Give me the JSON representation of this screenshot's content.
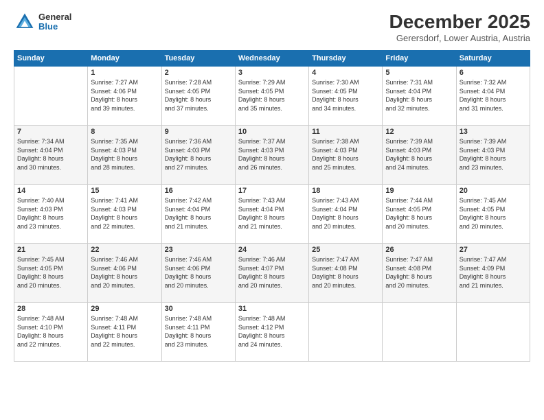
{
  "logo": {
    "general": "General",
    "blue": "Blue"
  },
  "title": "December 2025",
  "location": "Gerersdorf, Lower Austria, Austria",
  "days_of_week": [
    "Sunday",
    "Monday",
    "Tuesday",
    "Wednesday",
    "Thursday",
    "Friday",
    "Saturday"
  ],
  "weeks": [
    [
      {
        "day": "",
        "sunrise": "",
        "sunset": "",
        "daylight": ""
      },
      {
        "day": "1",
        "sunrise": "Sunrise: 7:27 AM",
        "sunset": "Sunset: 4:06 PM",
        "daylight": "Daylight: 8 hours and 39 minutes."
      },
      {
        "day": "2",
        "sunrise": "Sunrise: 7:28 AM",
        "sunset": "Sunset: 4:05 PM",
        "daylight": "Daylight: 8 hours and 37 minutes."
      },
      {
        "day": "3",
        "sunrise": "Sunrise: 7:29 AM",
        "sunset": "Sunset: 4:05 PM",
        "daylight": "Daylight: 8 hours and 35 minutes."
      },
      {
        "day": "4",
        "sunrise": "Sunrise: 7:30 AM",
        "sunset": "Sunset: 4:05 PM",
        "daylight": "Daylight: 8 hours and 34 minutes."
      },
      {
        "day": "5",
        "sunrise": "Sunrise: 7:31 AM",
        "sunset": "Sunset: 4:04 PM",
        "daylight": "Daylight: 8 hours and 32 minutes."
      },
      {
        "day": "6",
        "sunrise": "Sunrise: 7:32 AM",
        "sunset": "Sunset: 4:04 PM",
        "daylight": "Daylight: 8 hours and 31 minutes."
      }
    ],
    [
      {
        "day": "7",
        "sunrise": "Sunrise: 7:34 AM",
        "sunset": "Sunset: 4:04 PM",
        "daylight": "Daylight: 8 hours and 30 minutes."
      },
      {
        "day": "8",
        "sunrise": "Sunrise: 7:35 AM",
        "sunset": "Sunset: 4:03 PM",
        "daylight": "Daylight: 8 hours and 28 minutes."
      },
      {
        "day": "9",
        "sunrise": "Sunrise: 7:36 AM",
        "sunset": "Sunset: 4:03 PM",
        "daylight": "Daylight: 8 hours and 27 minutes."
      },
      {
        "day": "10",
        "sunrise": "Sunrise: 7:37 AM",
        "sunset": "Sunset: 4:03 PM",
        "daylight": "Daylight: 8 hours and 26 minutes."
      },
      {
        "day": "11",
        "sunrise": "Sunrise: 7:38 AM",
        "sunset": "Sunset: 4:03 PM",
        "daylight": "Daylight: 8 hours and 25 minutes."
      },
      {
        "day": "12",
        "sunrise": "Sunrise: 7:39 AM",
        "sunset": "Sunset: 4:03 PM",
        "daylight": "Daylight: 8 hours and 24 minutes."
      },
      {
        "day": "13",
        "sunrise": "Sunrise: 7:39 AM",
        "sunset": "Sunset: 4:03 PM",
        "daylight": "Daylight: 8 hours and 23 minutes."
      }
    ],
    [
      {
        "day": "14",
        "sunrise": "Sunrise: 7:40 AM",
        "sunset": "Sunset: 4:03 PM",
        "daylight": "Daylight: 8 hours and 23 minutes."
      },
      {
        "day": "15",
        "sunrise": "Sunrise: 7:41 AM",
        "sunset": "Sunset: 4:03 PM",
        "daylight": "Daylight: 8 hours and 22 minutes."
      },
      {
        "day": "16",
        "sunrise": "Sunrise: 7:42 AM",
        "sunset": "Sunset: 4:04 PM",
        "daylight": "Daylight: 8 hours and 21 minutes."
      },
      {
        "day": "17",
        "sunrise": "Sunrise: 7:43 AM",
        "sunset": "Sunset: 4:04 PM",
        "daylight": "Daylight: 8 hours and 21 minutes."
      },
      {
        "day": "18",
        "sunrise": "Sunrise: 7:43 AM",
        "sunset": "Sunset: 4:04 PM",
        "daylight": "Daylight: 8 hours and 20 minutes."
      },
      {
        "day": "19",
        "sunrise": "Sunrise: 7:44 AM",
        "sunset": "Sunset: 4:05 PM",
        "daylight": "Daylight: 8 hours and 20 minutes."
      },
      {
        "day": "20",
        "sunrise": "Sunrise: 7:45 AM",
        "sunset": "Sunset: 4:05 PM",
        "daylight": "Daylight: 8 hours and 20 minutes."
      }
    ],
    [
      {
        "day": "21",
        "sunrise": "Sunrise: 7:45 AM",
        "sunset": "Sunset: 4:05 PM",
        "daylight": "Daylight: 8 hours and 20 minutes."
      },
      {
        "day": "22",
        "sunrise": "Sunrise: 7:46 AM",
        "sunset": "Sunset: 4:06 PM",
        "daylight": "Daylight: 8 hours and 20 minutes."
      },
      {
        "day": "23",
        "sunrise": "Sunrise: 7:46 AM",
        "sunset": "Sunset: 4:06 PM",
        "daylight": "Daylight: 8 hours and 20 minutes."
      },
      {
        "day": "24",
        "sunrise": "Sunrise: 7:46 AM",
        "sunset": "Sunset: 4:07 PM",
        "daylight": "Daylight: 8 hours and 20 minutes."
      },
      {
        "day": "25",
        "sunrise": "Sunrise: 7:47 AM",
        "sunset": "Sunset: 4:08 PM",
        "daylight": "Daylight: 8 hours and 20 minutes."
      },
      {
        "day": "26",
        "sunrise": "Sunrise: 7:47 AM",
        "sunset": "Sunset: 4:08 PM",
        "daylight": "Daylight: 8 hours and 20 minutes."
      },
      {
        "day": "27",
        "sunrise": "Sunrise: 7:47 AM",
        "sunset": "Sunset: 4:09 PM",
        "daylight": "Daylight: 8 hours and 21 minutes."
      }
    ],
    [
      {
        "day": "28",
        "sunrise": "Sunrise: 7:48 AM",
        "sunset": "Sunset: 4:10 PM",
        "daylight": "Daylight: 8 hours and 22 minutes."
      },
      {
        "day": "29",
        "sunrise": "Sunrise: 7:48 AM",
        "sunset": "Sunset: 4:11 PM",
        "daylight": "Daylight: 8 hours and 22 minutes."
      },
      {
        "day": "30",
        "sunrise": "Sunrise: 7:48 AM",
        "sunset": "Sunset: 4:11 PM",
        "daylight": "Daylight: 8 hours and 23 minutes."
      },
      {
        "day": "31",
        "sunrise": "Sunrise: 7:48 AM",
        "sunset": "Sunset: 4:12 PM",
        "daylight": "Daylight: 8 hours and 24 minutes."
      },
      {
        "day": "",
        "sunrise": "",
        "sunset": "",
        "daylight": ""
      },
      {
        "day": "",
        "sunrise": "",
        "sunset": "",
        "daylight": ""
      },
      {
        "day": "",
        "sunrise": "",
        "sunset": "",
        "daylight": ""
      }
    ]
  ]
}
